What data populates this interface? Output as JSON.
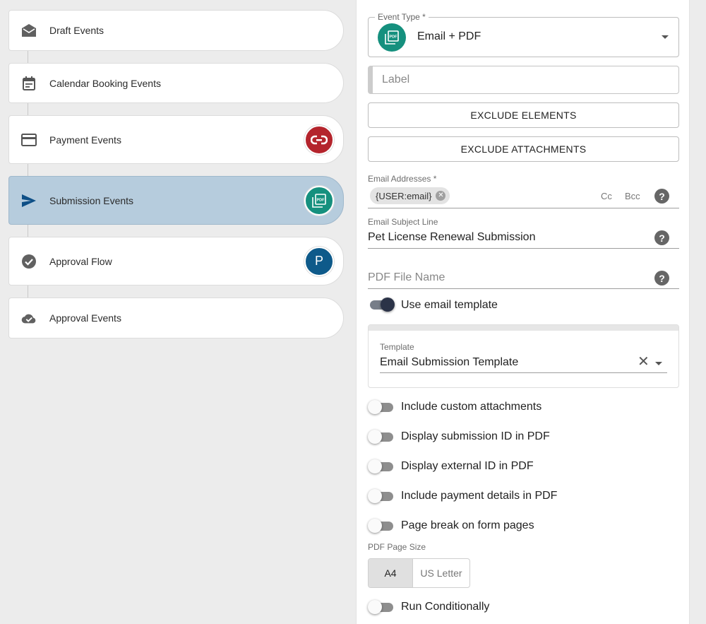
{
  "steps": [
    {
      "label": "Draft Events",
      "icon": "envelope-open-icon"
    },
    {
      "label": "Calendar Booking Events",
      "icon": "calendar-icon"
    },
    {
      "label": "Payment Events",
      "icon": "credit-card-icon",
      "badge": "payment-integration-icon",
      "badge_color": "#b4242c"
    },
    {
      "label": "Submission Events",
      "icon": "send-icon",
      "badge": "pdf-icon",
      "badge_color": "#15907e",
      "active": true
    },
    {
      "label": "Approval Flow",
      "icon": "check-circle-icon",
      "badge_letter": "P",
      "badge_color": "#0e5a8a"
    },
    {
      "label": "Approval Events",
      "icon": "cloud-done-icon"
    }
  ],
  "event_type": {
    "legend": "Event Type *",
    "value": "Email + PDF"
  },
  "label_field": {
    "placeholder": "Label"
  },
  "buttons": {
    "exclude_elements": "EXCLUDE ELEMENTS",
    "exclude_attachments": "EXCLUDE ATTACHMENTS"
  },
  "email_addresses": {
    "label": "Email Addresses *",
    "chip": "{USER:email}",
    "cc": "Cc",
    "bcc": "Bcc"
  },
  "email_subject": {
    "label": "Email Subject Line",
    "value": "Pet License Renewal Submission"
  },
  "pdf_file_name": {
    "placeholder": "PDF File Name"
  },
  "use_email_template": {
    "label": "Use email template",
    "on": true
  },
  "template": {
    "label": "Template",
    "value": "Email Submission Template"
  },
  "toggles": [
    {
      "label": "Include custom attachments",
      "on": false
    },
    {
      "label": "Display submission ID in PDF",
      "on": false
    },
    {
      "label": "Display external ID in PDF",
      "on": false
    },
    {
      "label": "Include payment details in PDF",
      "on": false
    },
    {
      "label": "Page break on form pages",
      "on": false
    }
  ],
  "pdf_page_size": {
    "label": "PDF Page Size",
    "options": [
      "A4",
      "US Letter"
    ],
    "selected": "A4"
  },
  "run_conditionally": {
    "label": "Run Conditionally",
    "on": false
  },
  "colors": {
    "active_step": "#b6ccdd",
    "accent_teal": "#15907e",
    "send_blue": "#0e4f86"
  }
}
